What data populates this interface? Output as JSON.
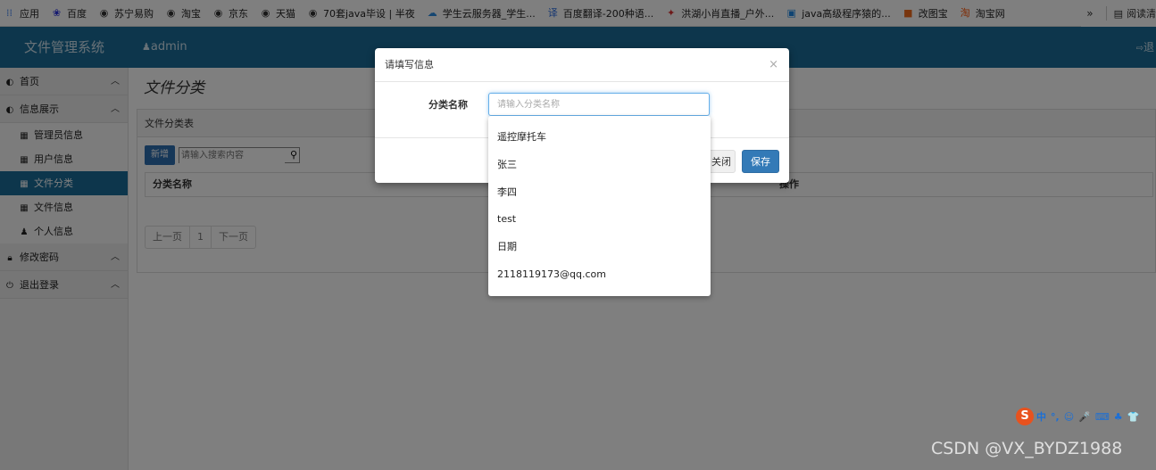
{
  "bookmarks": {
    "items": [
      {
        "label": "应用",
        "icon": "apps-grid-icon",
        "color": "#4285f4"
      },
      {
        "label": "百度",
        "icon": "baidu-paw-icon",
        "color": "#2932e1"
      },
      {
        "label": "苏宁易购",
        "icon": "globe-icon",
        "color": "#333333"
      },
      {
        "label": "淘宝",
        "icon": "globe-icon",
        "color": "#333333"
      },
      {
        "label": "京东",
        "icon": "globe-icon",
        "color": "#333333"
      },
      {
        "label": "天猫",
        "icon": "globe-icon",
        "color": "#333333"
      },
      {
        "label": "70套java毕设 | 半夜",
        "icon": "globe-icon",
        "color": "#333333"
      },
      {
        "label": "学生云服务器_学生...",
        "icon": "cloud-icon",
        "color": "#2b8de3"
      },
      {
        "label": "百度翻译-200种语...",
        "icon": "translate-icon",
        "color": "#2b6de3"
      },
      {
        "label": "洪湖小肖直播_户外...",
        "icon": "bird-icon",
        "color": "#d33"
      },
      {
        "label": "java高级程序猿的...",
        "icon": "tv-icon",
        "color": "#1e88e5"
      },
      {
        "label": "改图宝",
        "icon": "orange-square-icon",
        "color": "#f06a1c"
      },
      {
        "label": "淘宝网",
        "icon": "taobao-icon",
        "color": "#ff5000"
      }
    ],
    "more": "»",
    "reading_list": "阅读清"
  },
  "header": {
    "brand": "文件管理系统",
    "user": "admin",
    "logout_partial": "退"
  },
  "sidebar": {
    "groups": [
      {
        "label": "首页",
        "icon": "dashboard-icon",
        "caret": "^"
      },
      {
        "label": "信息展示",
        "icon": "dashboard-icon",
        "caret": "^"
      }
    ],
    "sub_items": [
      {
        "label": "管理员信息",
        "icon": "table-icon",
        "active": false
      },
      {
        "label": "用户信息",
        "icon": "table-icon",
        "active": false
      },
      {
        "label": "文件分类",
        "icon": "table-icon",
        "active": true
      },
      {
        "label": "文件信息",
        "icon": "table-icon",
        "active": false
      },
      {
        "label": "个人信息",
        "icon": "user-icon",
        "active": false
      }
    ],
    "bottom_groups": [
      {
        "label": "修改密码",
        "icon": "lock-icon",
        "caret": "^"
      },
      {
        "label": "退出登录",
        "icon": "power-icon",
        "caret": "^"
      }
    ]
  },
  "main": {
    "page_title": "文件分类",
    "panel_title": "文件分类表",
    "new_button": "新增",
    "search_placeholder": "请输入搜索内容",
    "columns": [
      "分类名称",
      "操作"
    ],
    "pager": {
      "prev": "上一页",
      "page": "1",
      "next": "下一页"
    }
  },
  "modal": {
    "title": "请填写信息",
    "close_x": "×",
    "field_label": "分类名称",
    "field_placeholder": "请输入分类名称",
    "close_button": "关闭",
    "save_button": "保存"
  },
  "autocomplete": {
    "items": [
      "遥控摩托车",
      "张三",
      "李四",
      "test",
      "日期",
      "2118119173@qq.com"
    ]
  },
  "ime": {
    "logo": "S",
    "glyphs": [
      "中",
      "°,",
      "☺",
      "🎤",
      "⌨",
      "♣",
      "👕"
    ]
  },
  "watermark": "CSDN @VX_BYDZ1988",
  "colors": {
    "header_bg": "#1a6c98",
    "active_item_bg": "#1a6c98",
    "primary_button": "#337ab7",
    "new_button": "#2d6fb1"
  }
}
